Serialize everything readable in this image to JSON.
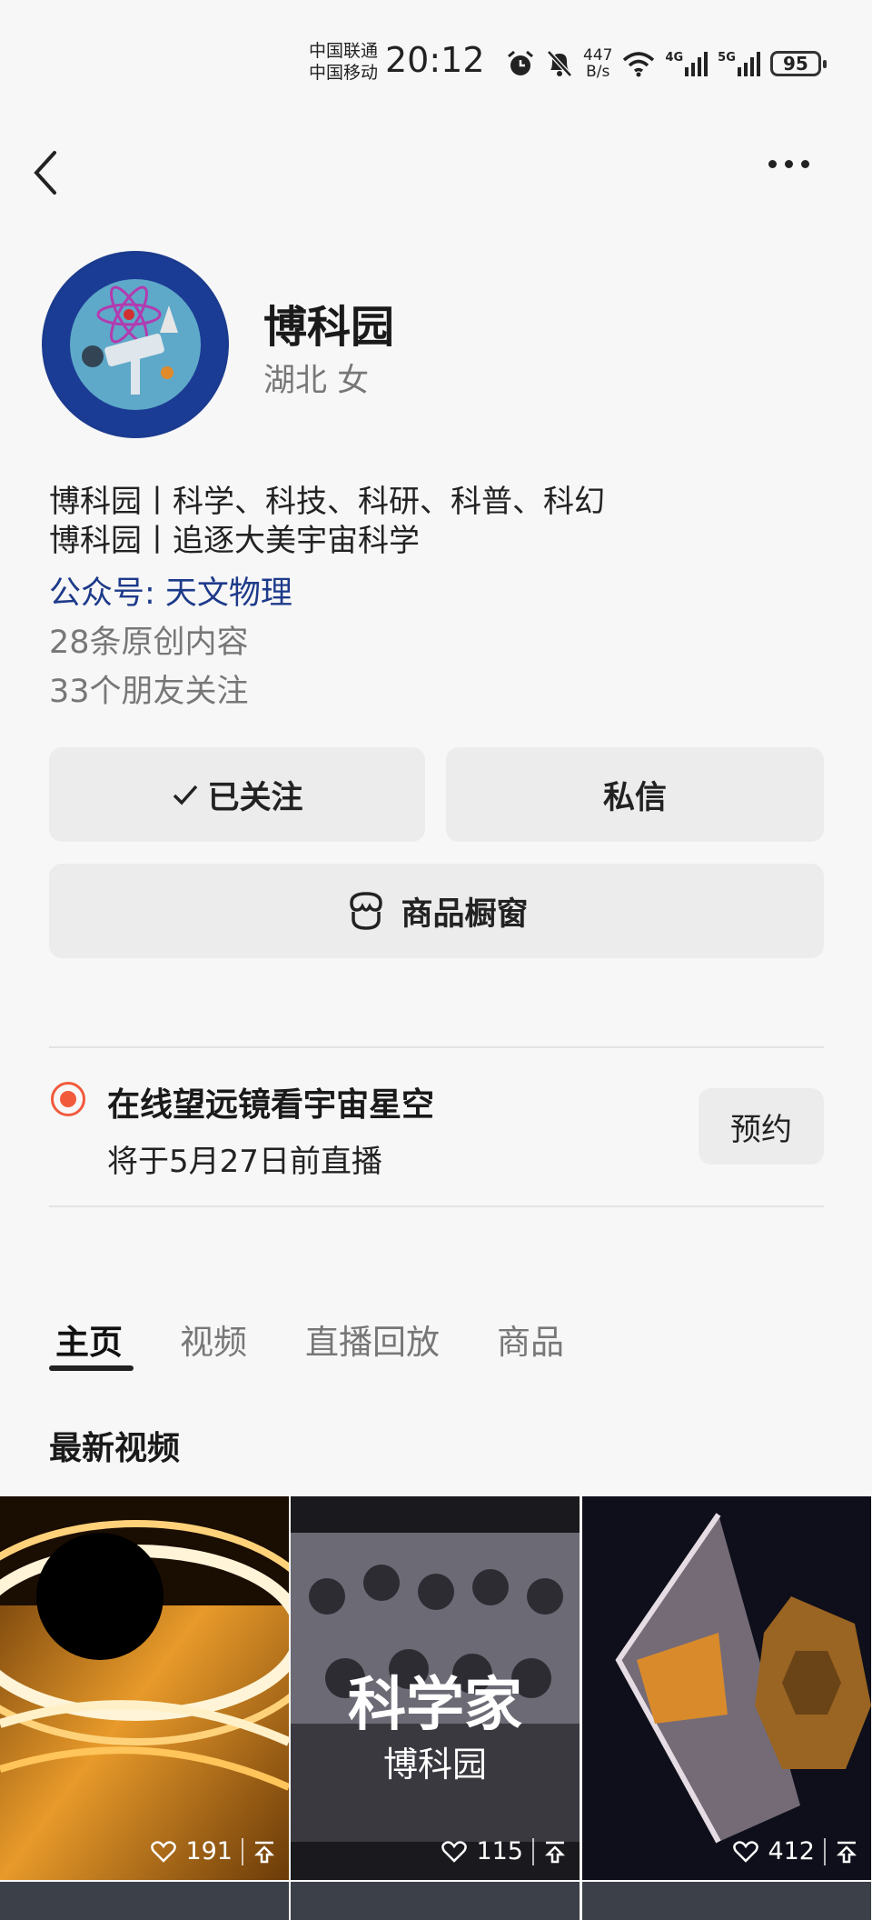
{
  "status_bar": {
    "carrier1": "中国联通",
    "carrier2": "中国移动",
    "time": "20:12",
    "net_speed_value": "447",
    "net_speed_unit": "B/s",
    "signal1": "4G",
    "signal2": "5G",
    "battery": "95"
  },
  "profile": {
    "name": "博科园",
    "location_gender": "湖北 女",
    "bio_line1": "博科园丨科学、科技、科研、科普、科幻",
    "bio_line2": "博科园丨追逐大美宇宙科学",
    "official_account": "公众号: 天文物理",
    "original_count": "28条原创内容",
    "friends_following": "33个朋友关注"
  },
  "buttons": {
    "followed": "已关注",
    "message": "私信",
    "shop": "商品橱窗"
  },
  "live": {
    "title": "在线望远镜看宇宙星空",
    "schedule": "将于5月27日前直播",
    "reserve": "预约"
  },
  "tabs": [
    "主页",
    "视频",
    "直播回放",
    "商品"
  ],
  "section_title": "最新视频",
  "videos": [
    {
      "likes": "191"
    },
    {
      "likes": "115",
      "overlay_title": "科学家",
      "overlay_sub": "博科园"
    },
    {
      "likes": "412"
    }
  ],
  "colors": {
    "accent": "#1d3a8a",
    "live": "#f15a3b",
    "button_bg": "#ececec"
  }
}
